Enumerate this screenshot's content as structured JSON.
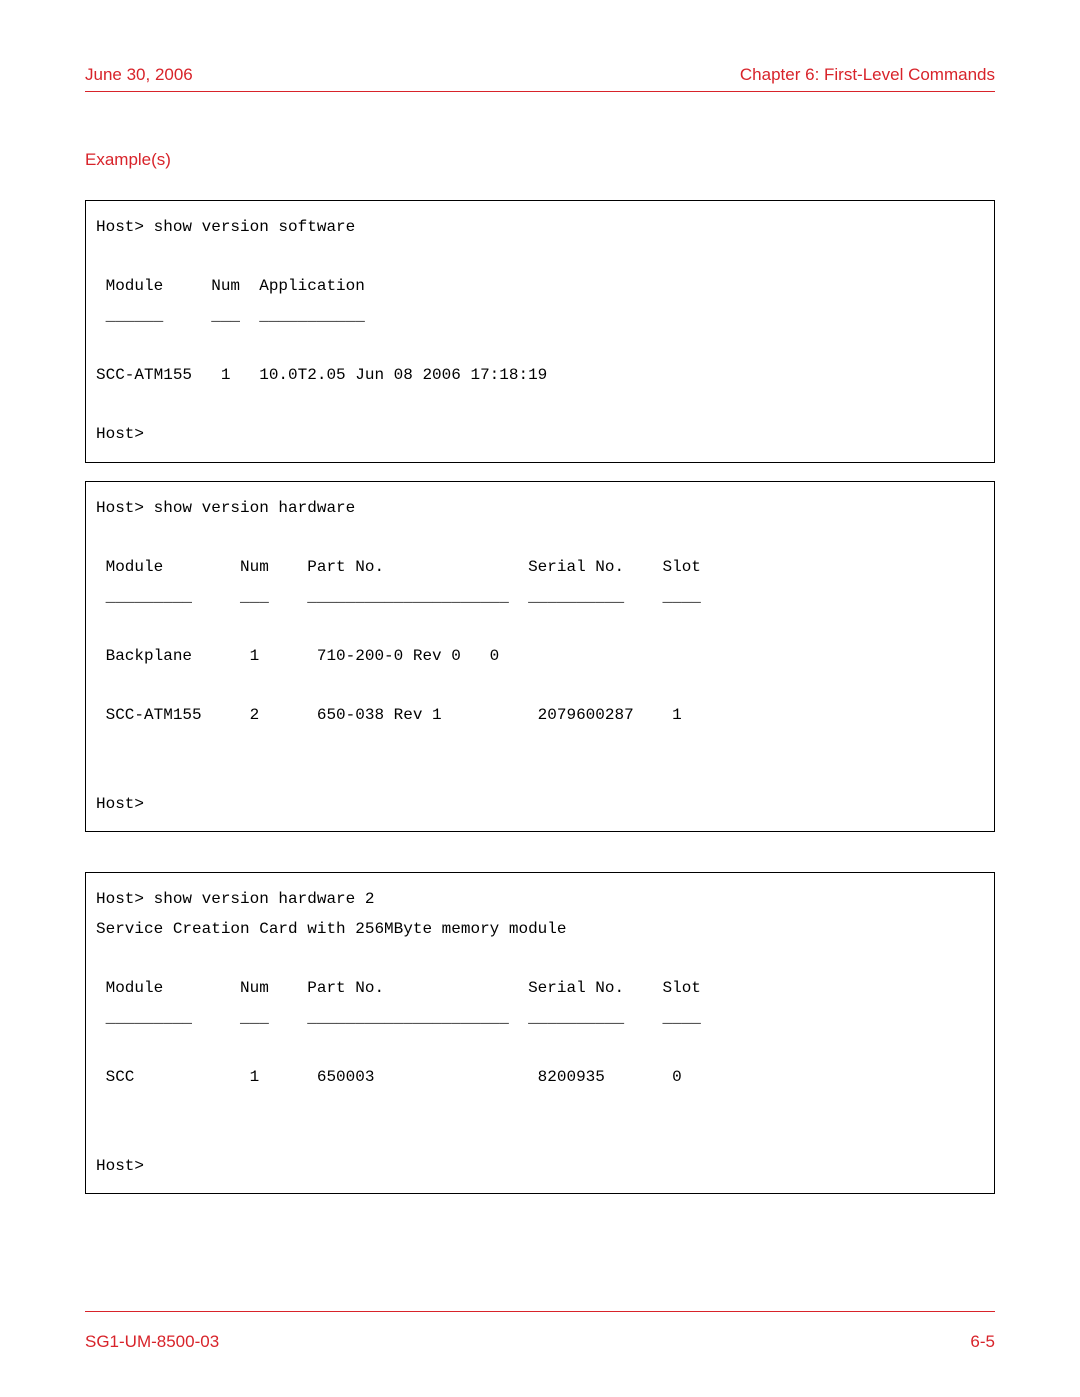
{
  "header": {
    "date": "June 30, 2006",
    "chapter": "Chapter 6: First-Level Commands"
  },
  "section_title": "Example(s)",
  "terminals": {
    "box1": "Host> show version software\n\n Module     Num  Application\n ______     ___  ___________\n\nSCC-ATM155   1   10.0T2.05 Jun 08 2006 17:18:19\n\nHost>",
    "box2": "Host> show version hardware\n\n Module        Num    Part No.               Serial No.    Slot\n _________     ___    _____________________  __________    ____\n\n Backplane      1      710-200-0 Rev 0   0\n\n SCC-ATM155     2      650-038 Rev 1          2079600287    1\n\n\nHost>",
    "box3": "Host> show version hardware 2\nService Creation Card with 256MByte memory module\n\n Module        Num    Part No.               Serial No.    Slot\n _________     ___    _____________________  __________    ____\n\n SCC            1      650003                 8200935       0\n\n\nHost>"
  },
  "footer": {
    "doc_id": "SG1-UM-8500-03",
    "page_num": "6-5"
  }
}
